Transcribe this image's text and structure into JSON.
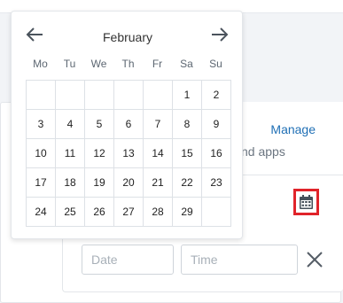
{
  "apps_card": {
    "manage_label": "Manage",
    "apps_text": "nd apps"
  },
  "datetime": {
    "calendar_icon": "calendar-icon",
    "date_placeholder": "Date",
    "time_placeholder": "Time",
    "clear_icon": "close-icon",
    "highlight_color": "#e0232a"
  },
  "calendar": {
    "month": "February",
    "prev_icon": "arrow-left-icon",
    "next_icon": "arrow-right-icon",
    "weekdays": [
      "Mo",
      "Tu",
      "We",
      "Th",
      "Fr",
      "Sa",
      "Su"
    ],
    "weeks": [
      [
        "",
        "",
        "",
        "",
        "",
        "1",
        "2"
      ],
      [
        "3",
        "4",
        "5",
        "6",
        "7",
        "8",
        "9"
      ],
      [
        "10",
        "11",
        "12",
        "13",
        "14",
        "15",
        "16"
      ],
      [
        "17",
        "18",
        "19",
        "20",
        "21",
        "22",
        "23"
      ],
      [
        "24",
        "25",
        "26",
        "27",
        "28",
        "29",
        ""
      ]
    ]
  },
  "colors": {
    "link": "#1f6fb5",
    "text": "#333333",
    "grid_line": "#dde1e6"
  }
}
